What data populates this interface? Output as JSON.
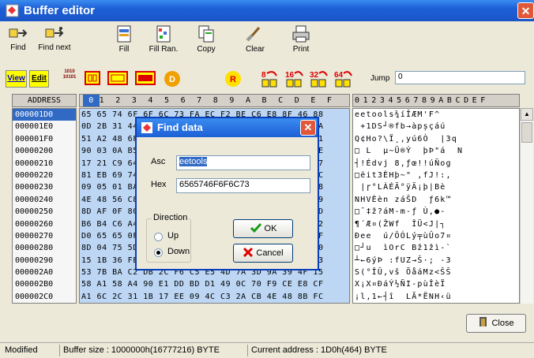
{
  "window": {
    "title": "Buffer editor",
    "close": "✕"
  },
  "toolbar": {
    "find": "Find",
    "find_next": "Find next",
    "fill": "Fill",
    "fill_ran": "Fill Ran.",
    "copy": "Copy",
    "clear": "Clear",
    "print": "Print"
  },
  "bar2": {
    "view": "View",
    "edit": "Edit",
    "bits": "1010\n10101",
    "d": "D",
    "r": "R",
    "b8": "8",
    "b16": "16",
    "b32": "32",
    "b64": "64",
    "jump_label": "Jump",
    "jump_value": "0"
  },
  "header": {
    "address": "ADDRESS",
    "hex_columns": [
      "0",
      "1",
      "2",
      "3",
      "4",
      "5",
      "6",
      "7",
      "8",
      "9",
      "A",
      "B",
      "C",
      "D",
      "E",
      "F"
    ],
    "ascii_columns": "0123456789ABCDEF"
  },
  "rows": [
    {
      "addr": "000001D0",
      "hex": "65 65 74 6F 6F 6C 73 FA EC F2 BE C6 E8 8F 46 88",
      "ascii": "eetools¾íÎÆM'F^"
    },
    {
      "addr": "000001E0",
      "hex": "0D 2B 31 44 53 F9 F3 20 E6 BB 3B 20 2E 86 31 FA",
      "ascii": " +1DS┘®fb→àpșçáú"
    },
    {
      "addr": "000001F0",
      "hex": "51 A2 48 6F 3F 5C 49 AF 20 A5 BA D4 A1 D2 20 71",
      "ascii": "Q¢Ho?\\Ï¸,yú6Ò  |3q"
    },
    {
      "addr": "00000200",
      "hex": "90 03 0A B5 81 91 DC 82 DD 20 FE DE A8 B4 20 4E",
      "ascii": "□ L  µ~Ü®Ý  þÞ\"á  N"
    },
    {
      "addr": "00000210",
      "hex": "17 21 C9 64 76 6A 20 38 2C 9F 21 FA D1 6F 67 67",
      "ascii": "┤!Édvj 8,ƒœ!!úÑog"
    },
    {
      "addr": "00000220",
      "hex": "81 EB 69 74 33 C8 48 FE 7E 22 20 20 66 4A 21 2C",
      "ascii": "□ëit3ÈHþ~\" ,fJ!:,"
    },
    {
      "addr": "00000230",
      "hex": "09 05 01 BA C0 C5 C4 B0 FF C4 AB 3B A1 FE 42 E8",
      "ascii": " |ɼ°LÀÉÄ°ÿÄ¡þ|Bè"
    },
    {
      "addr": "00000240",
      "hex": "4E 48 56 C8 E8 6E 20 7A E1 53 D0 20 FB 36 6B 99",
      "ascii": "NHVÈèn záŠD  ƒ6k™"
    },
    {
      "addr": "00000250",
      "hex": "8D AF 0F 80 32 3F 61 4D 2D 6D 2D 83 20 D9 2C 2D",
      "ascii": "□¯‡ž?áM-m-ƒ Ù,●-"
    },
    {
      "addr": "00000260",
      "hex": "B6 B4 C6 A4 28 5A 57 66 20 CE DC 0A 4A 7C 02 02",
      "ascii": "¶´Æ¤(ŽWf  ÎÜ<J|┐"
    },
    {
      "addr": "00000270",
      "hex": "D0 65 65 0F 20 FA 2F D4 D3 4C FD B2 F9 DB 6F 0F",
      "ascii": "Ðee  ú/ÔÓLý╤ùÛo7¤"
    },
    {
      "addr": "00000280",
      "hex": "8D 04 75 5D 05 69 4F 72 43 20 42 B9 7A EC 2D 60",
      "ascii": "□┘u  ìOrC Bž1žì-`"
    },
    {
      "addr": "00000290",
      "hex": "15 1B 36 FE 0A 3A 46 55 5A 3A 9A 3B 20 2D 33 33",
      "ascii": "┴←6ýÞ :fUZ→Š·; -3"
    },
    {
      "addr": "000002A0",
      "hex": "53 7B BA C2 DB 2C F6 C5 E5 4D 7A 3D 9A 39 4F 15",
      "ascii": "S(°ÎÛ,vš ÕåáMz<ŠŠ"
    },
    {
      "addr": "000002B0",
      "hex": "58 A1 58 A4 90 E1 DD BD D1 49 0C 70 F9 CE E8 CF",
      "ascii": "X¡X¤ĐáÝ½ÑI-pùÎèÏ"
    },
    {
      "addr": "000002C0",
      "hex": "A1 6C 2C 31 1B 17 EE 09 4C C3 2A CB 4E 48 8B FC",
      "ascii": "¡l,1←┤î  LÃ*ËNH‹ü"
    }
  ],
  "close_button": "Close",
  "status": {
    "mode": "Modified",
    "size": "Buffer size : 1000000h(16777216) BYTE",
    "address": "Current address : 1D0h(464) BYTE"
  },
  "dialog": {
    "title": "Find data",
    "asc_label": "Asc",
    "asc_value": "eetools",
    "hex_label": "Hex",
    "hex_value": "6565746F6F6C73",
    "direction_label": "Direction",
    "up": "Up",
    "down": "Down",
    "ok": "OK",
    "cancel": "Cancel"
  },
  "colors": {
    "title_blue": "#1d5fd6",
    "hex_bg": "#bcd6f4",
    "selection": "#316ac5",
    "yellow": "#ffff00"
  }
}
